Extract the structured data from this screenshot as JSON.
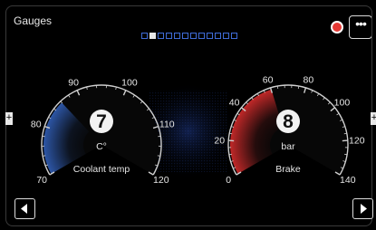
{
  "app": {
    "title": "Gauges"
  },
  "pager": {
    "count": 12,
    "active_index": 1
  },
  "gauges": [
    {
      "id": "coolant",
      "value": "7",
      "unit": "C°",
      "name": "Coolant temp",
      "ticks": [
        "70",
        "80",
        "90",
        "100",
        "110",
        "120"
      ],
      "fill_fraction": 0.32,
      "color": "#2f5bb0"
    },
    {
      "id": "brake",
      "value": "8",
      "unit": "bar",
      "name": "Brake",
      "ticks": [
        "0",
        "20",
        "40",
        "60",
        "80",
        "100",
        "120",
        "140"
      ],
      "fill_fraction": 0.43,
      "color": "#cc2a2a"
    }
  ],
  "icons": {
    "menu": "more-horizontal-icon",
    "record": "record-indicator-icon",
    "prev": "arrow-left-icon",
    "next": "arrow-right-icon"
  },
  "glyphs": {
    "menu": "•••",
    "edge_left": "+",
    "edge_right": "+"
  }
}
